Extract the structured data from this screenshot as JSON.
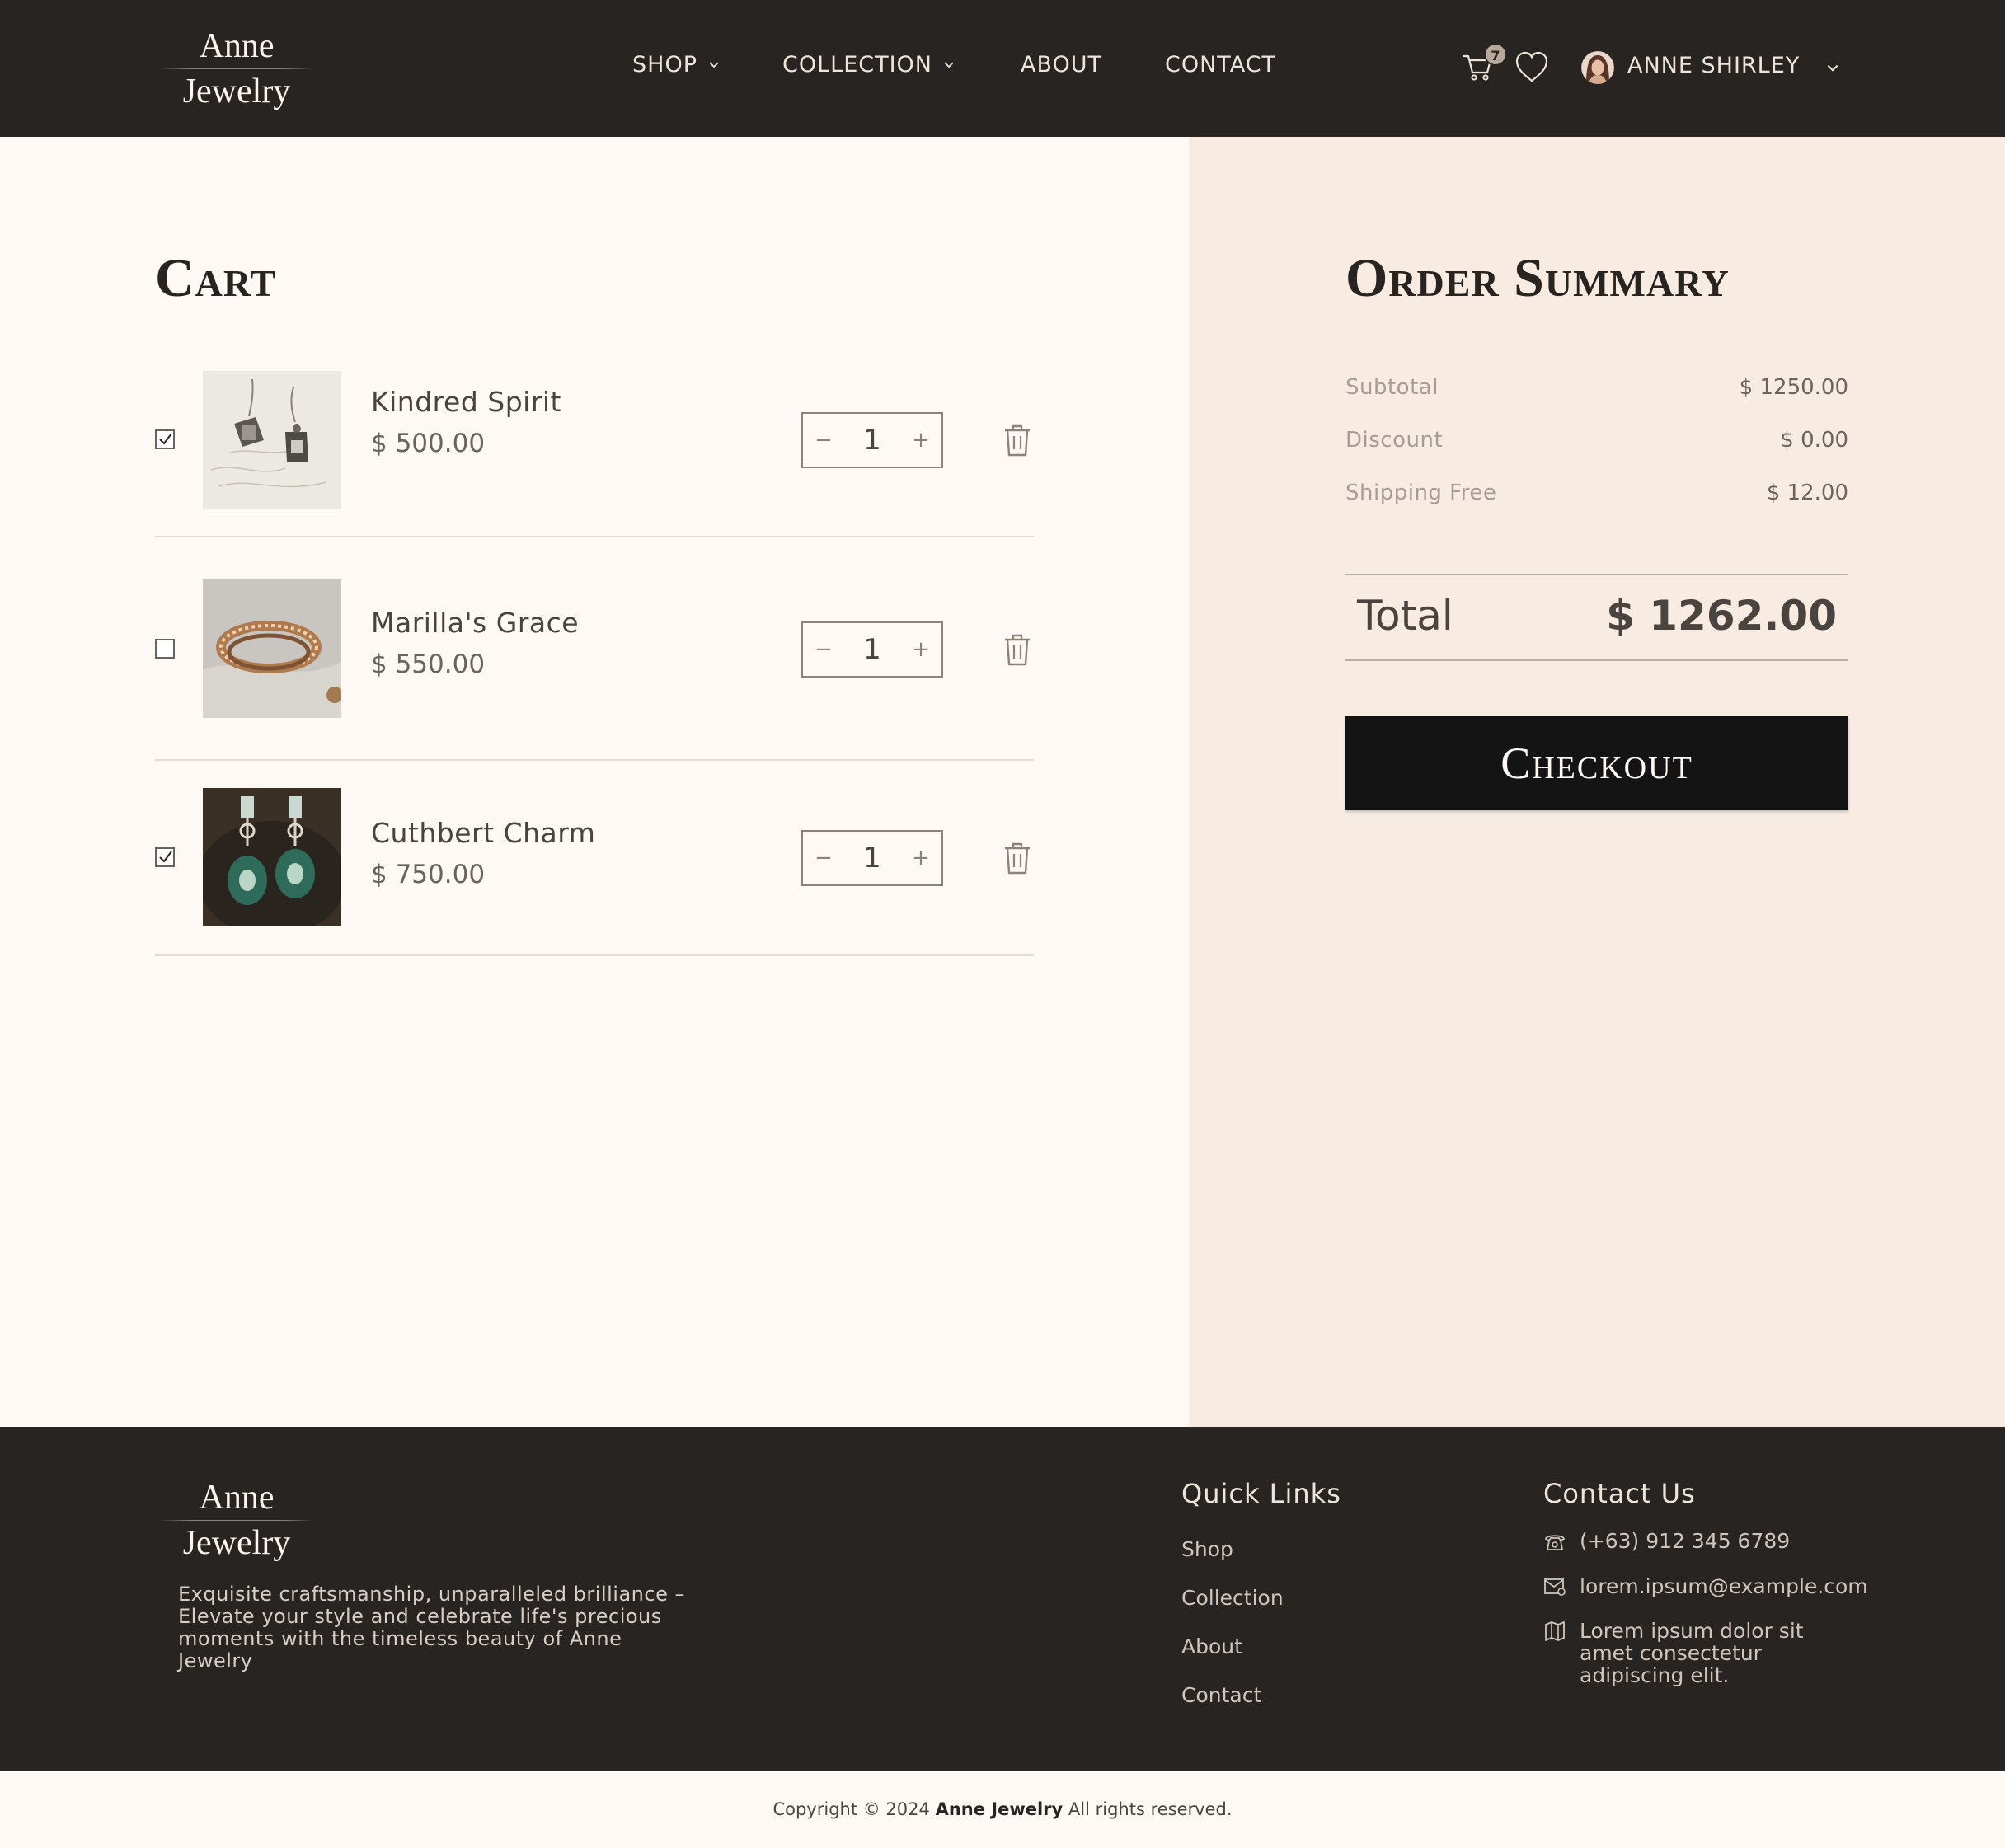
{
  "brand": {
    "line1": "Anne",
    "line2": "Jewelry"
  },
  "nav": {
    "shop": "SHOP",
    "collection": "COLLECTION",
    "about": "ABOUT",
    "contact": "CONTACT"
  },
  "user": {
    "name": "ANNE SHIRLEY",
    "cart_count": "7"
  },
  "cart": {
    "title": "Cart",
    "items": [
      {
        "name": "Kindred Spirit",
        "price": "$ 500.00",
        "qty": "1",
        "checked": true
      },
      {
        "name": "Marilla's Grace",
        "price": "$ 550.00",
        "qty": "1",
        "checked": false
      },
      {
        "name": "Cuthbert Charm",
        "price": "$ 750.00",
        "qty": "1",
        "checked": true
      }
    ],
    "minus": "−",
    "plus": "+"
  },
  "summary": {
    "title": "Order Summary",
    "subtotal_label": "Subtotal",
    "subtotal_value": "$ 1250.00",
    "discount_label": "Discount",
    "discount_value": "$ 0.00",
    "shipping_label": "Shipping Free",
    "shipping_value": "$ 12.00",
    "total_label": "Total",
    "total_value": "$ 1262.00",
    "checkout_label": "Checkout"
  },
  "footer": {
    "tagline": "Exquisite craftsmanship, unparalleled brilliance – Elevate your style and celebrate life's precious moments with the timeless beauty of Anne Jewelry",
    "quick_links_heading": "Quick Links",
    "links": [
      "Shop",
      "Collection",
      "About",
      "Contact"
    ],
    "contact_heading": "Contact Us",
    "phone": "(+63) 912 345 6789",
    "email": "lorem.ipsum@example.com",
    "address": "Lorem ipsum dolor sit amet consectetur adipiscing elit."
  },
  "copyright": {
    "prefix": "Copyright © 2024",
    "brand": "Anne Jewelry",
    "suffix": "All rights reserved."
  },
  "colors": {
    "nav_bg": "#282421",
    "page_bg": "#fef9f4",
    "summary_bg": "#f7ebe2",
    "checkout_bg": "#141414"
  }
}
